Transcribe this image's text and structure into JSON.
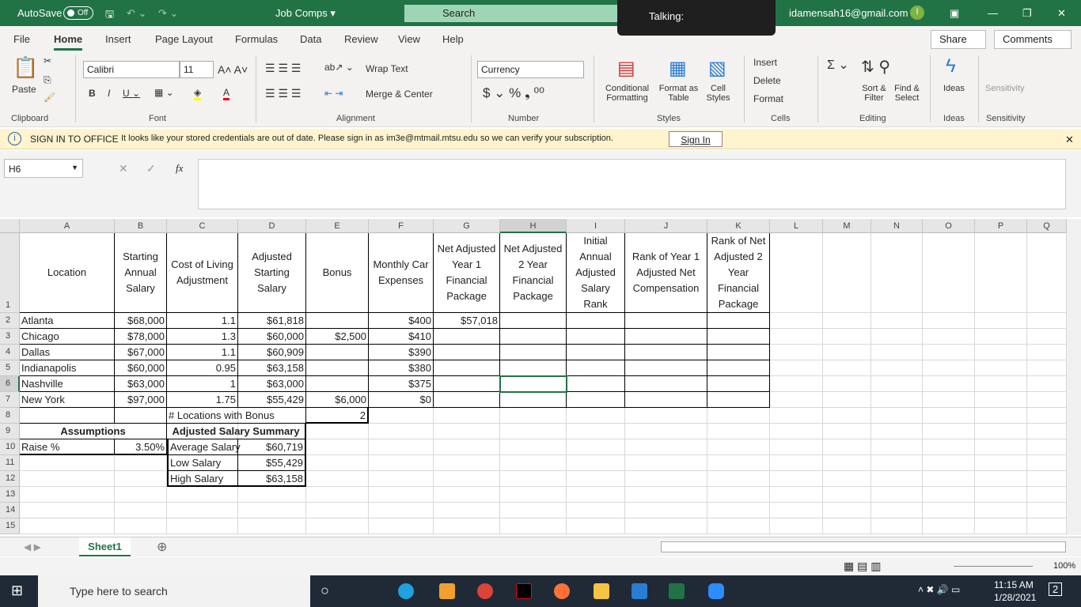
{
  "titlebar": {
    "autosave": "AutoSave",
    "toggle": "Off",
    "doc": "Job Comps ▾",
    "search": "Search",
    "talking": "Talking:",
    "email": "idamensah16@gmail.com",
    "avatar": "I"
  },
  "tabs": [
    "File",
    "Home",
    "Insert",
    "Page Layout",
    "Formulas",
    "Data",
    "Review",
    "View",
    "Help"
  ],
  "share": "Share",
  "comments": "Comments",
  "ribbon": {
    "paste": "Paste",
    "font": "Calibri",
    "size": "11",
    "wrap": "Wrap Text",
    "merge": "Merge & Center",
    "numfmt": "Currency",
    "cond": "Conditional Formatting",
    "fmttable": "Format as Table",
    "cellstyles": "Cell Styles",
    "insert": "Insert",
    "delete": "Delete",
    "format": "Format",
    "sort": "Sort & Filter",
    "find": "Find & Select",
    "ideas": "Ideas",
    "sensitivity": "Sensitivity",
    "groups": [
      "Clipboard",
      "Font",
      "Alignment",
      "Number",
      "Styles",
      "Cells",
      "Editing",
      "Ideas",
      "Sensitivity"
    ]
  },
  "message": {
    "title": "SIGN IN TO OFFICE",
    "text": "It looks like your stored credentials are out of date. Please sign in as im3e@mtmail.mtsu.edu so we can verify your subscription.",
    "button": "Sign In"
  },
  "namebox": "H6",
  "fx": "fx",
  "columns": [
    "A",
    "B",
    "C",
    "D",
    "E",
    "F",
    "G",
    "H",
    "I",
    "J",
    "K",
    "L",
    "M",
    "N",
    "O",
    "P",
    "Q"
  ],
  "header_row": [
    "Location",
    "Starting Annual Salary",
    "Cost of Living Adjustment",
    "Adjusted Starting Salary",
    "Bonus",
    "Monthly Car Expenses",
    "Net Adjusted Year 1 Financial Package",
    "Net Adjusted 2 Year Financial Package",
    "Initial Annual Adjusted Salary Rank",
    "Rank of Year 1 Adjusted Net Compensation",
    "Rank of Net Adjusted 2 Year Financial Package"
  ],
  "rows": [
    [
      "Atlanta",
      "$68,000",
      "1.1",
      "$61,818",
      "",
      "$400",
      "$57,018",
      "",
      "",
      "",
      ""
    ],
    [
      "Chicago",
      "$78,000",
      "1.3",
      "$60,000",
      "$2,500",
      "$410",
      "",
      "",
      "",
      "",
      ""
    ],
    [
      "Dallas",
      "$67,000",
      "1.1",
      "$60,909",
      "",
      "$390",
      "",
      "",
      "",
      "",
      ""
    ],
    [
      "Indianapolis",
      "$60,000",
      "0.95",
      "$63,158",
      "",
      "$380",
      "",
      "",
      "",
      "",
      ""
    ],
    [
      "Nashville",
      "$63,000",
      "1",
      "$63,000",
      "",
      "$375",
      "",
      "",
      "",
      "",
      ""
    ],
    [
      "New York",
      "$97,000",
      "1.75",
      "$55,429",
      "$6,000",
      "$0",
      "",
      "",
      "",
      "",
      ""
    ]
  ],
  "bonus_count": {
    "label": "# Locations with Bonus",
    "value": "2"
  },
  "assumptions": {
    "title": "Assumptions",
    "label": "Raise %",
    "value": "3.50%"
  },
  "summary": {
    "title": "Adjusted Salary Summary",
    "items": [
      [
        "Average Salary",
        "$60,719"
      ],
      [
        "Low Salary",
        "$55,429"
      ],
      [
        "High Salary",
        "$63,158"
      ]
    ]
  },
  "sheet": "Sheet1",
  "zoom": "100%",
  "taskbar": {
    "search": "Type here to search",
    "time": "11:15 AM",
    "date": "1/28/2021",
    "notif": "2"
  }
}
